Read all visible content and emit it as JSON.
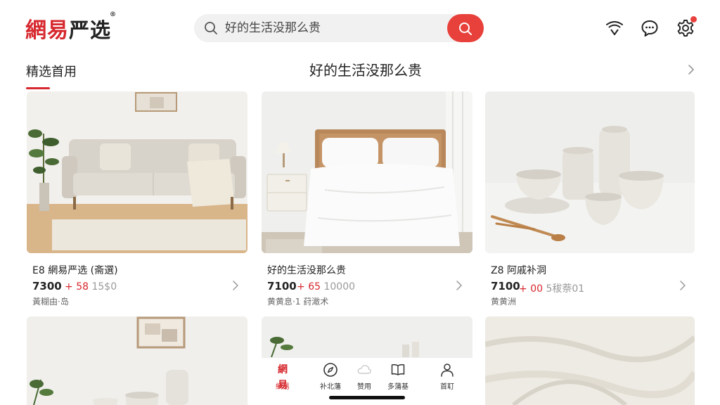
{
  "header": {
    "logo_main": "網易",
    "logo_suffix": "严选",
    "logo_reg": "®",
    "search_placeholder": "好的生活没那么贵"
  },
  "section": {
    "left_title": "精选首用",
    "center_title": "好的生活没那么贵"
  },
  "products": [
    {
      "name": "E8 網易严选 (斋選)",
      "price": "7300",
      "tag_prefix": "+",
      "tag_price": "58",
      "tag_orig": "15$0",
      "sub": "黃糊由·岛"
    },
    {
      "name": "好的生活没那么贵",
      "price": "7100",
      "tag_prefix": "+",
      "tag_price": "65",
      "tag_orig": "10000",
      "sub": "黄黄息·1 荮澉术"
    },
    {
      "name": "Z8 阿戚补洞",
      "price": "7100",
      "tag_prefix": "+",
      "tag_price": "00",
      "tag_orig": "5秡萘01",
      "sub": "黄黄洲"
    }
  ],
  "tabs": [
    {
      "label": "網易",
      "icon": "brand-logo-icon",
      "brand": "網易",
      "active": true
    },
    {
      "label": "补北藩",
      "icon": "compass-icon",
      "active": false
    },
    {
      "label": "赞用",
      "icon": "cloud-icon",
      "active": false
    },
    {
      "label": "多蒲基",
      "icon": "book-icon",
      "active": false
    },
    {
      "label": "首耵",
      "icon": "person-icon",
      "active": false
    }
  ],
  "colors": {
    "accent": "#d6282e",
    "search_button": "#e8403a"
  }
}
